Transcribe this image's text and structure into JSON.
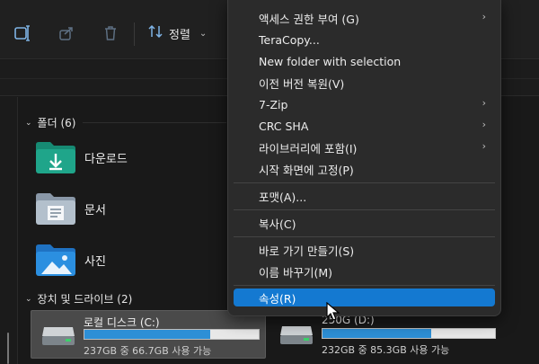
{
  "toolbar": {
    "icons": [
      "rename-icon",
      "share-icon",
      "delete-icon"
    ],
    "sort_label": "정렬",
    "sort_icon": "sort-arrows-icon"
  },
  "groups": {
    "folders_header": "폴더 (6)",
    "drives_header": "장치 및 드라이브 (2)"
  },
  "folders": [
    {
      "label": "다운로드",
      "icon": "downloads-folder-icon"
    },
    {
      "label": "문서",
      "icon": "documents-folder-icon"
    },
    {
      "label": "사진",
      "icon": "pictures-folder-icon"
    }
  ],
  "drives": [
    {
      "name": "로컬 디스크 (C:)",
      "meta": "237GB 중 66.7GB 사용 가능",
      "used_fraction": 0.72,
      "selected": true
    },
    {
      "name": "250G (D:)",
      "meta": "232GB 중 85.3GB 사용 가능",
      "used_fraction": 0.63,
      "selected": false
    }
  ],
  "context_menu": {
    "items": [
      {
        "label": "액세스 권한 부여 (G)",
        "submenu": true
      },
      {
        "label": "TeraCopy...",
        "submenu": false
      },
      {
        "label": "New folder with selection",
        "submenu": false
      },
      {
        "label": "이전 버전 복원(V)",
        "submenu": false
      },
      {
        "label": "7-Zip",
        "submenu": true
      },
      {
        "label": "CRC SHA",
        "submenu": true
      },
      {
        "label": "라이브러리에 포함(I)",
        "submenu": true
      },
      {
        "label": "시작 화면에 고정(P)",
        "submenu": false
      },
      {
        "label": "포맷(A)...",
        "submenu": false
      },
      {
        "label": "복사(C)",
        "submenu": false
      },
      {
        "label": "바로 가기 만들기(S)",
        "submenu": false
      },
      {
        "label": "이름 바꾸기(M)",
        "submenu": false
      },
      {
        "label": "속성(R)",
        "submenu": false,
        "highlighted": true
      }
    ]
  },
  "colors": {
    "accent": "#1479d1",
    "drive_fill": "#2d8fd6",
    "folder_teal": "#1fa58a",
    "folder_blue": "#2b8fe0"
  }
}
